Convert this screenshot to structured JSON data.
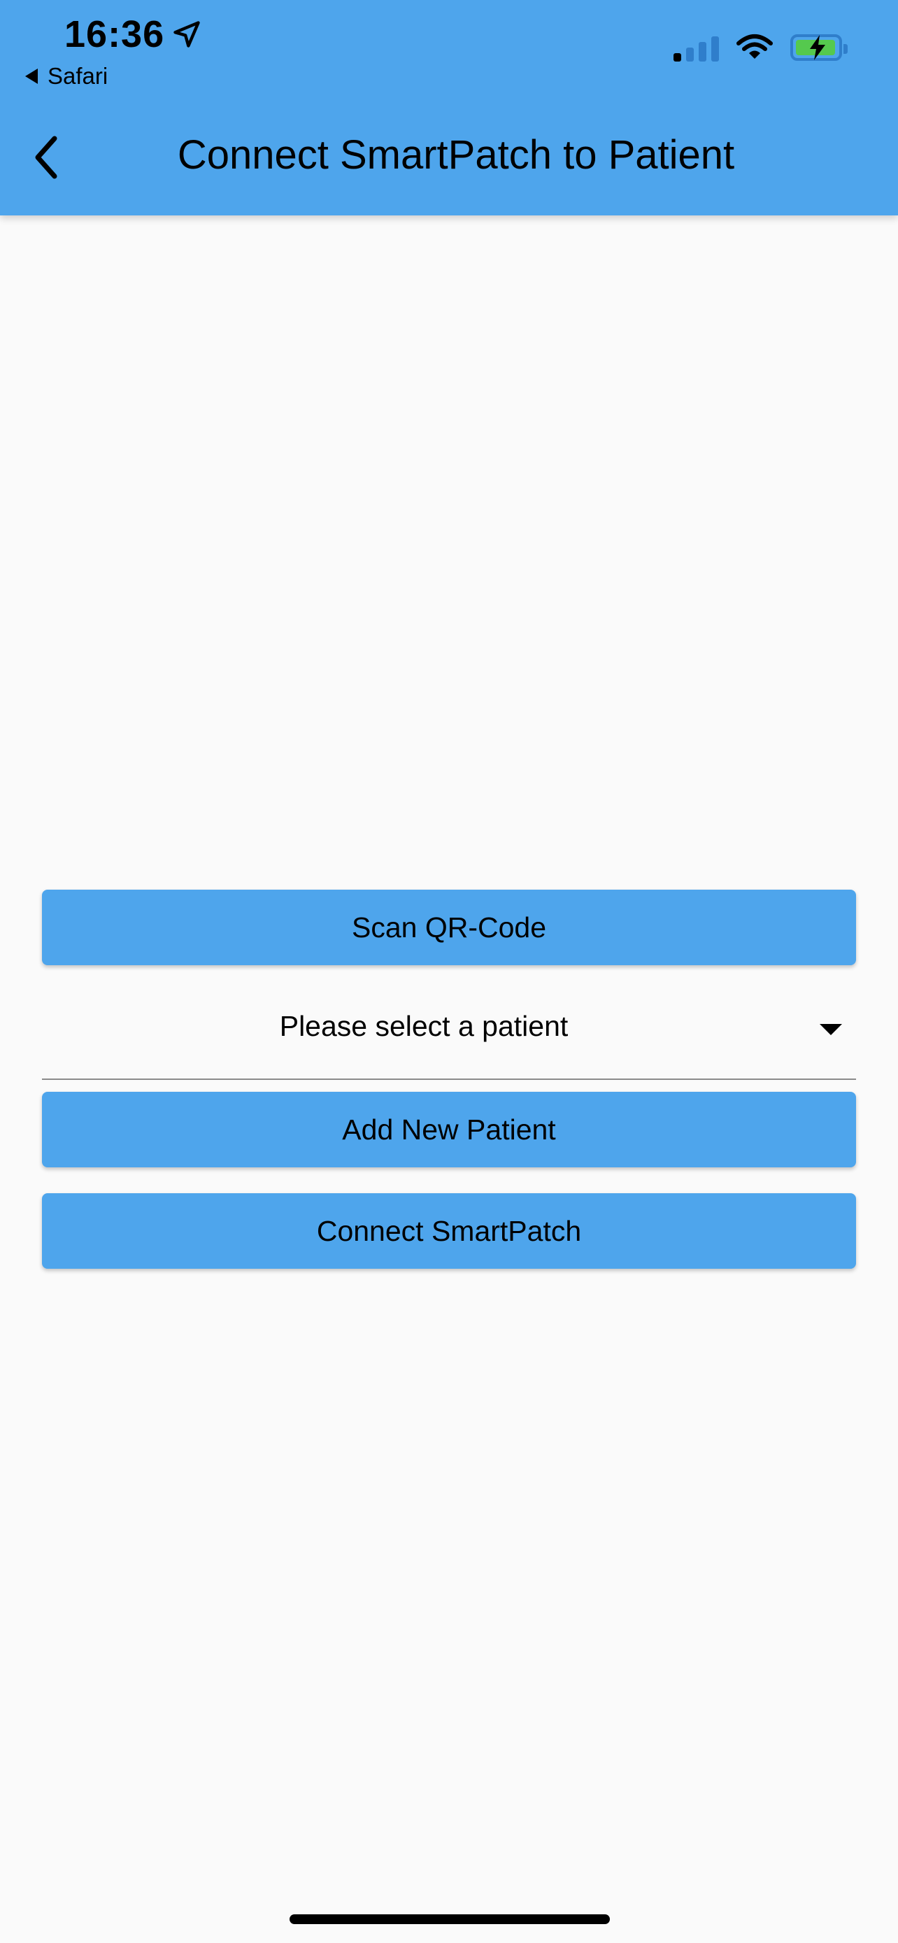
{
  "status_bar": {
    "time": "16:36",
    "back_app": "Safari",
    "location_icon": "location-arrow-icon",
    "signal_icon": "cellular-signal-icon",
    "wifi_icon": "wifi-icon",
    "battery_icon": "battery-charging-icon"
  },
  "app_bar": {
    "title": "Connect SmartPatch to Patient",
    "back_icon": "chevron-left-icon",
    "color": "#4ea5ec"
  },
  "actions": {
    "scan_label": "Scan QR-Code",
    "add_patient_label": "Add New Patient",
    "connect_label": "Connect SmartPatch"
  },
  "patient_select": {
    "value": "Please select a patient",
    "icon": "dropdown-arrow-icon"
  }
}
